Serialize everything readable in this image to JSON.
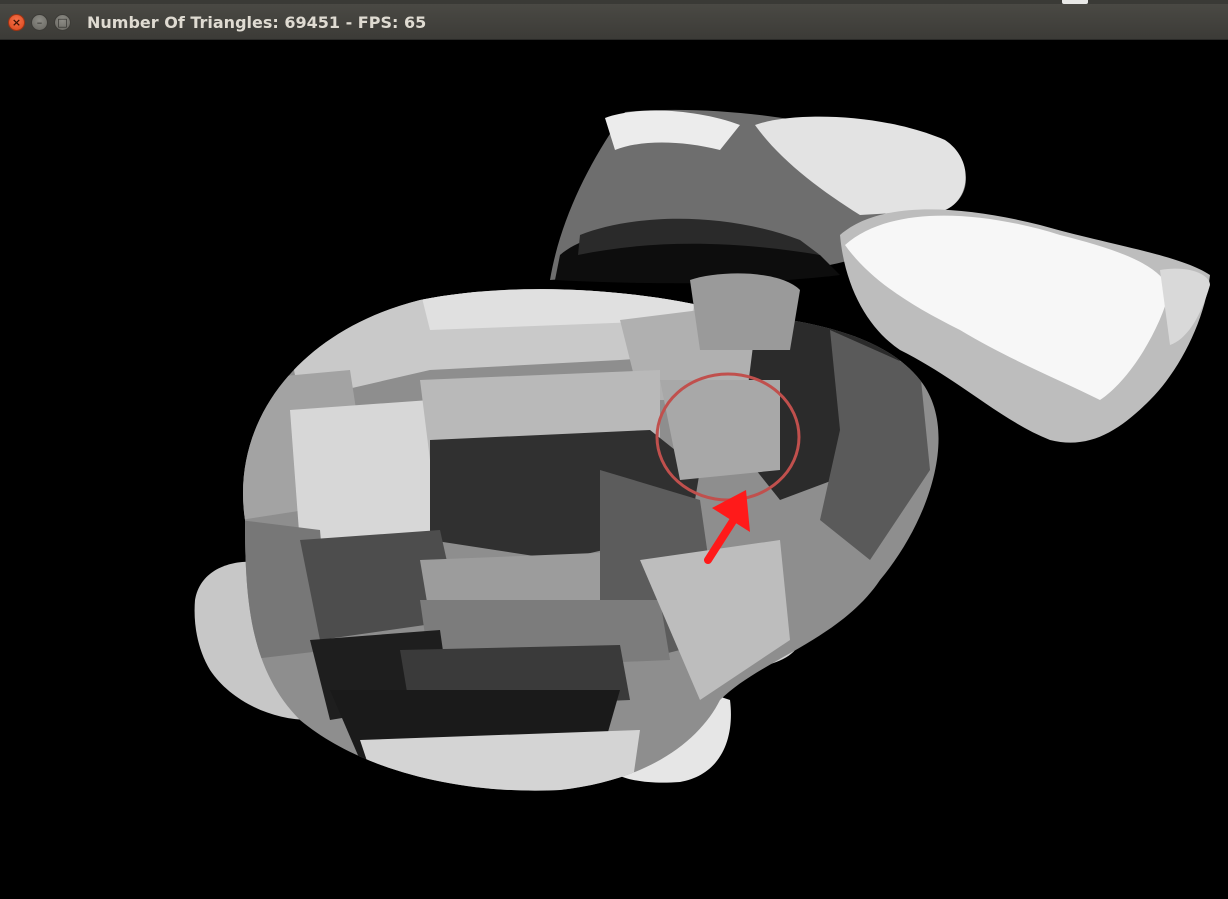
{
  "window": {
    "title": "Number Of Triangles: 69451 - FPS: 65",
    "buttons": {
      "close_icon": "close-icon",
      "minimize_icon": "minimize-icon",
      "maximize_icon": "maximize-icon"
    }
  },
  "viewport": {
    "background": "#000000",
    "model": "segmented-mesh",
    "annotation": {
      "circle_color": "#c0504d",
      "arrow_color": "#ff1a1a"
    }
  }
}
